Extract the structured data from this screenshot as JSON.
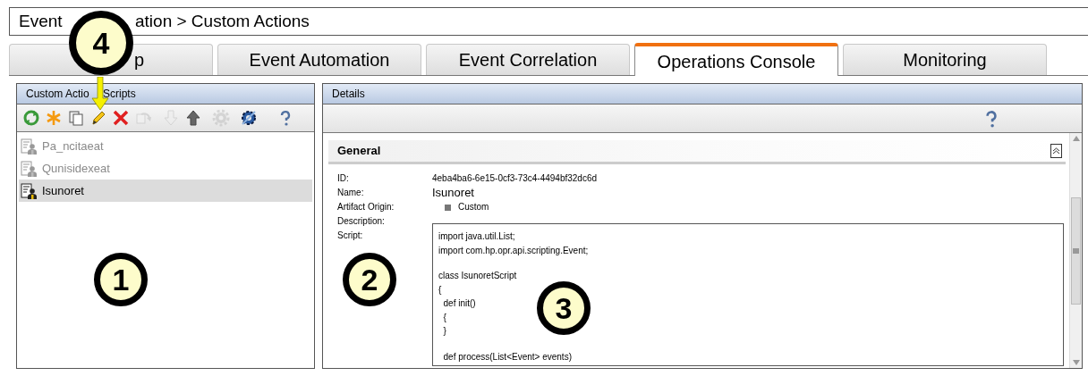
{
  "breadcrumb": [
    "Event",
    "ation > Custom Actions"
  ],
  "tabs": [
    {
      "label": "p",
      "selected": false
    },
    {
      "label": "Event Automation",
      "selected": false
    },
    {
      "label": "Event Correlation",
      "selected": false
    },
    {
      "label": "Operations Console",
      "selected": true
    },
    {
      "label": "Monitoring",
      "selected": false
    }
  ],
  "left_panel": {
    "title": [
      "Custom Actio",
      "Scripts"
    ],
    "toolbar": [
      {
        "kind": "refresh",
        "disabled": false
      },
      {
        "kind": "new",
        "disabled": false
      },
      {
        "kind": "copy",
        "disabled": false
      },
      {
        "kind": "edit",
        "disabled": false
      },
      {
        "kind": "delete",
        "disabled": false
      },
      {
        "kind": "revert",
        "disabled": true
      },
      {
        "kind": "down",
        "disabled": true
      },
      {
        "kind": "up",
        "disabled": false
      },
      {
        "kind": "gear",
        "disabled": true
      },
      {
        "kind": "unlink",
        "disabled": false
      },
      {
        "kind": "help",
        "disabled": false
      }
    ],
    "items": [
      {
        "label": "Pa_ncitaeat",
        "enabled": false,
        "selected": false
      },
      {
        "label": "Qunisidexeat",
        "enabled": false,
        "selected": false
      },
      {
        "label": "Isunoret",
        "enabled": true,
        "selected": true
      }
    ]
  },
  "details": {
    "title": "Details",
    "section": {
      "title": "General",
      "expanded": true
    },
    "fields": [
      {
        "label": "ID:",
        "value": "4eba4ba6-6e15-0cf3-73c4-4494bf32dc6d",
        "kind": "text"
      },
      {
        "label": "Name:",
        "value": "Isunoret",
        "kind": "large"
      },
      {
        "label": "Artifact Origin:",
        "value": "Custom",
        "kind": "origin"
      },
      {
        "label": "Description:",
        "kind": "text"
      },
      {
        "label": "Script:",
        "kind": "script",
        "blocks": [
          [
            "import java.util.List;",
            "import com.hp.opr.api.scripting.Event;"
          ],
          [
            "class IsunoretScript",
            "{",
            "  def init()",
            "  {",
            "  }"
          ],
          [
            "  def process(List<Event> events)"
          ]
        ]
      }
    ]
  },
  "callouts": [
    {
      "number": "1"
    },
    {
      "number": "2"
    },
    {
      "number": "3"
    },
    {
      "number": "4"
    }
  ]
}
